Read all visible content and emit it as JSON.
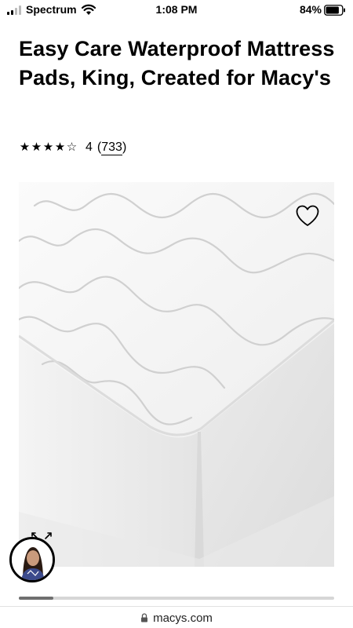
{
  "status_bar": {
    "carrier": "Spectrum",
    "time": "1:08 PM",
    "battery": "84%",
    "battery_level": 0.84
  },
  "product": {
    "title": "Easy Care Waterproof Mattress Pads, King, Created for Macy's",
    "rating": {
      "stars": [
        "★",
        "★",
        "★",
        "★",
        "☆"
      ],
      "value": "4",
      "open_paren": "(",
      "count": "733",
      "close_paren": ")"
    },
    "image_alt_icon": "heart-outline-icon"
  },
  "carousel": {
    "progress": 0.11
  },
  "browser": {
    "url": "macys.com"
  },
  "colors": {
    "text": "#000000",
    "progress_fill": "#6f6f6f",
    "progress_track": "#d6d6d6"
  }
}
